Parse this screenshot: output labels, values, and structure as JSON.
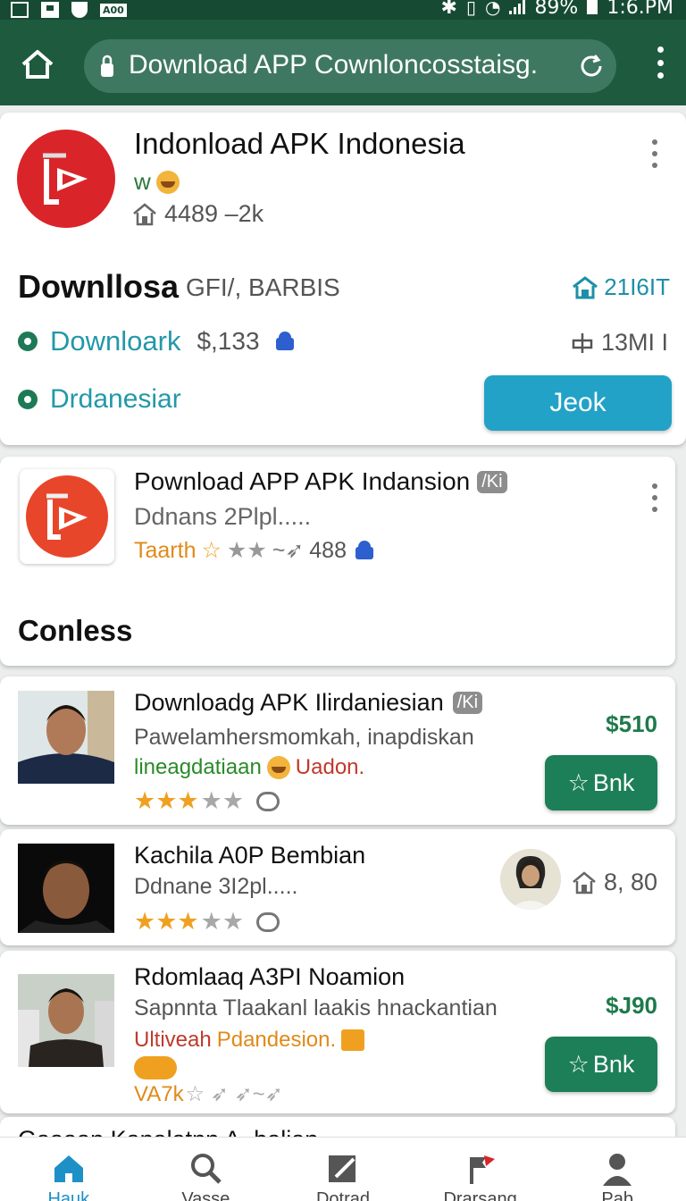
{
  "status_bar": {
    "left_tag": "A00",
    "battery": "89%",
    "time": "1:6.PM"
  },
  "browser": {
    "url": "Download APP Cownloncosstaisg.",
    "home_icon": "home-icon",
    "lock_icon": "lock-icon",
    "reload_icon": "reload-icon",
    "menu_icon": "more-vert-icon"
  },
  "featured": {
    "title": "Indonload APK Indonesia",
    "developer": "w",
    "stats": "4489 –2k",
    "heading": "Downllosa",
    "subheading": "GFI/, BARBIS",
    "right_label": "21I6IT",
    "row1_label": "Downloark",
    "row1_price": "$,133",
    "row1_right": "13MI I",
    "row2_label": "Drdanesiar",
    "button_label": "Jeok",
    "accent_color": "#22a2c6",
    "logo_color": "#d9252a"
  },
  "app_card": {
    "title": "Pownload APP APK Indansion",
    "tag": "/Ki",
    "subtitle": "Ddnans 2Plpl.....",
    "rating_label": "Taarth",
    "rating_count": "488",
    "section_heading": "Conless"
  },
  "list": [
    {
      "title": "Downloadg APK Ilirdaniesian",
      "tag": "/Ki",
      "subtitle": "Pawelamhersmomkah, inapdiskan",
      "tag_green": "lineagdatiaan",
      "tag_red": "Uadon.",
      "rating": 3,
      "price": "$510",
      "button": "Bnk"
    },
    {
      "title": "Kachila A0P Bembian",
      "subtitle": "Ddnane 3I2pl.....",
      "rating": 3,
      "right_value": "8, 80"
    },
    {
      "title": "Rdomlaaq A3PI Noamion",
      "subtitle": "Sapnnta Tlaakanl laakis hnackantian",
      "tag_red": "Ultiveah",
      "tag_orange": "Pdandesion.",
      "rating_text": "VA7k",
      "price": "$J90",
      "button": "Bnk"
    },
    {
      "title": "Gaaaan   Kanalatnn A..balian"
    }
  ],
  "bottom_nav": [
    {
      "label": "Hauk",
      "icon": "home-icon"
    },
    {
      "label": "Vasse",
      "icon": "search-icon"
    },
    {
      "label": "Dotrad",
      "icon": "edit-icon"
    },
    {
      "label": "Drarsang",
      "icon": "flag-icon"
    },
    {
      "label": "Pab",
      "icon": "profile-icon"
    }
  ]
}
